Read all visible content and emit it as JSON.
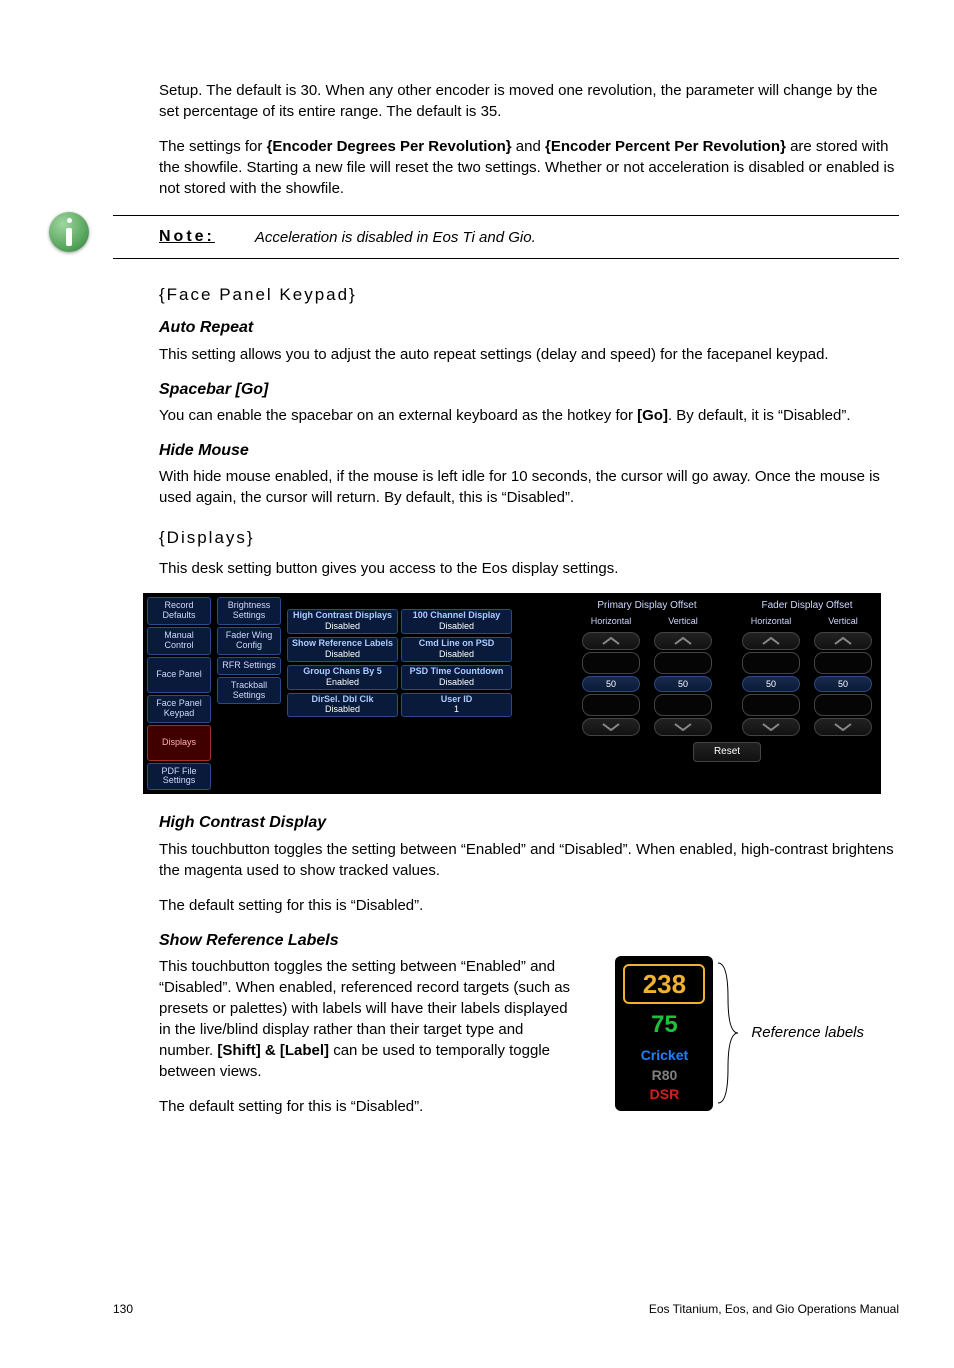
{
  "intro": {
    "p1": "Setup. The default is 30. When any other encoder is moved one revolution, the parameter will change by the set percentage of its entire range. The default is 35.",
    "p2_a": "The settings for ",
    "p2_b": "{Encoder Degrees Per Revolution}",
    "p2_c": " and ",
    "p2_d": "{Encoder Percent Per Revolution}",
    "p2_e": " are stored with the showfile. Starting a new file will reset the two settings. Whether or not acceleration is disabled or enabled is not stored with the showfile."
  },
  "note": {
    "label": "Note:",
    "text": "Acceleration is disabled in Eos Ti and Gio."
  },
  "facepanel": {
    "heading": "{Face Panel Keypad}",
    "auto_repeat": {
      "h": "Auto Repeat",
      "p": "This setting allows you to adjust the auto repeat settings (delay and speed) for the facepanel keypad."
    },
    "spacebar": {
      "h": "Spacebar [Go]",
      "p_a": "You can enable the spacebar on an external keyboard as the hotkey for ",
      "p_b": "[Go]",
      "p_c": ". By default, it is “Disabled”."
    },
    "hide_mouse": {
      "h": "Hide Mouse",
      "p": "With hide mouse enabled, if the mouse is left idle for 10 seconds, the cursor will go away. Once the mouse is used again, the cursor will return. By default, this is “Disabled”."
    }
  },
  "displays": {
    "heading": "{Displays}",
    "intro": "This desk setting button gives you access to the Eos display settings.",
    "nav": {
      "c1": [
        "Record Defaults",
        "Manual Control",
        "Face Panel",
        "Face Panel Keypad",
        "Displays",
        "PDF File Settings"
      ],
      "c2": [
        "Brightness Settings",
        "Fader Wing Config",
        "RFR Settings",
        "Trackball Settings"
      ]
    },
    "settings": [
      [
        {
          "lbl": "High Contrast Displays",
          "val": "Disabled"
        },
        {
          "lbl": "100 Channel Display",
          "val": "Disabled"
        }
      ],
      [
        {
          "lbl": "Show Reference Labels",
          "val": "Disabled"
        },
        {
          "lbl": "Cmd Line on PSD",
          "val": "Disabled"
        }
      ],
      [
        {
          "lbl": "Group Chans By 5",
          "val": "Enabled"
        },
        {
          "lbl": "PSD Time Countdown",
          "val": "Disabled"
        }
      ],
      [
        {
          "lbl": "DirSel. Dbl Clk",
          "val": "Disabled"
        },
        {
          "lbl": "User ID",
          "val": "1"
        }
      ]
    ],
    "offset": {
      "primary": {
        "title": "Primary Display Offset",
        "h": "Horizontal",
        "v": "Vertical",
        "hv": "50",
        "vv": "50"
      },
      "fader": {
        "title": "Fader Display Offset",
        "h": "Horizontal",
        "v": "Vertical",
        "hv": "50",
        "vv": "50"
      },
      "reset": "Reset"
    },
    "hcd": {
      "h": "High Contrast Display",
      "p1": "This touchbutton toggles the setting between “Enabled” and “Disabled”. When enabled, high-contrast brightens the magenta used to show tracked values.",
      "p2": "The default setting for this is “Disabled”."
    },
    "srl": {
      "h": "Show Reference Labels",
      "p1_a": "This touchbutton toggles the setting between “Enabled” and “Disabled”. When enabled, referenced record targets (such as presets or palettes) with labels will have their labels displayed in the live/blind display rather than their target type and number. ",
      "p1_b": "[Shift] & [Label]",
      "p1_c": " can be used to temporally toggle between views.",
      "p2": "The default setting for this is “Disabled”."
    },
    "ref_fig": {
      "n238": "238",
      "n75": "75",
      "cricket": "Cricket",
      "r80": "R80",
      "dsr": "DSR",
      "caption": "Reference labels"
    }
  },
  "footer": {
    "page": "130",
    "title": "Eos Titanium, Eos, and Gio Operations Manual"
  }
}
